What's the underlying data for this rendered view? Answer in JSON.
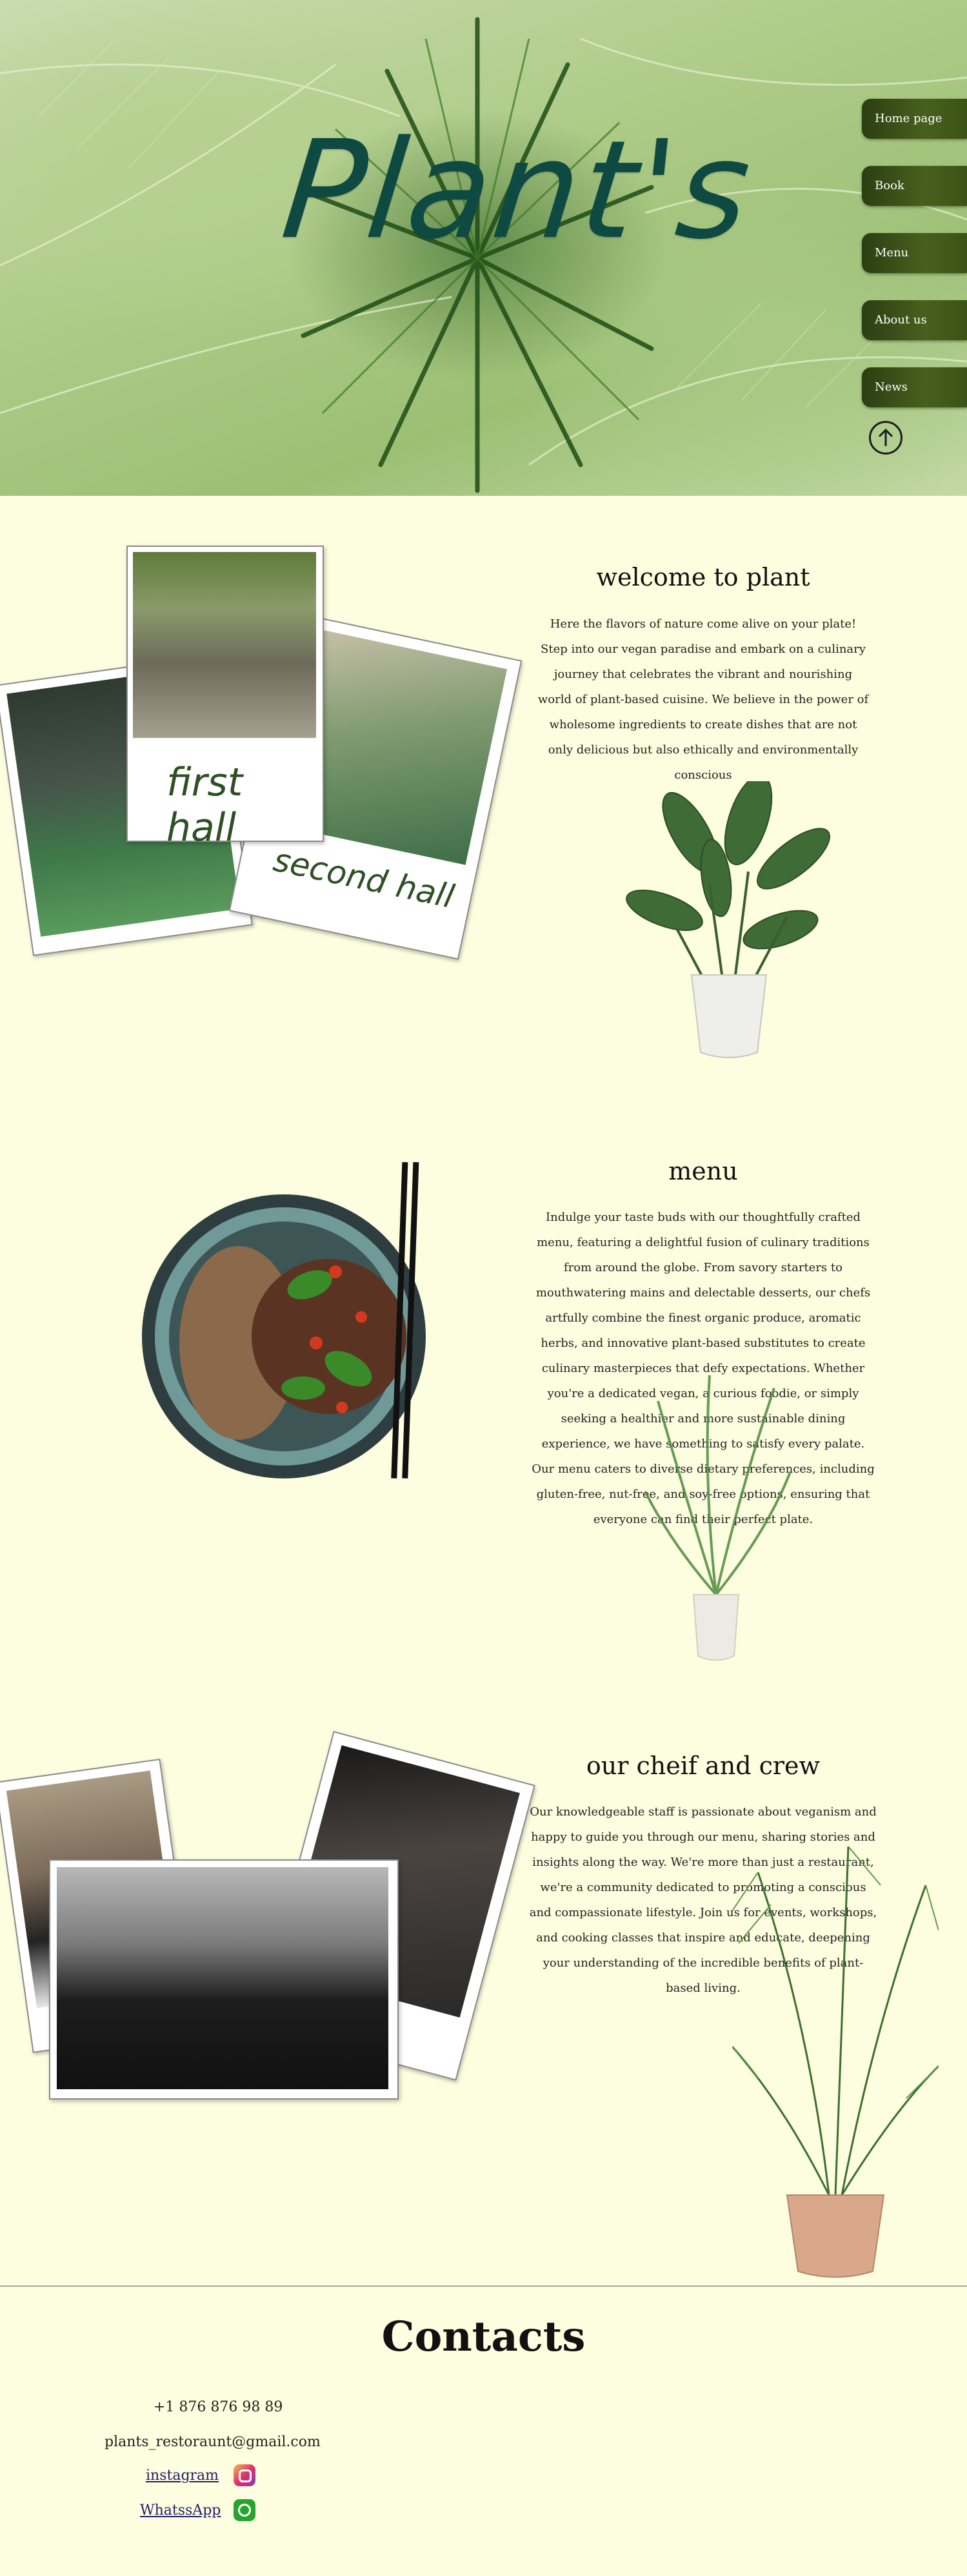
{
  "hero": {
    "title": "Plant's"
  },
  "nav": {
    "items": [
      "Home page",
      "Book",
      "Menu",
      "About us",
      "News"
    ],
    "up_icon": "arrow-up-circle-icon"
  },
  "welcome": {
    "title": "welcome to plant",
    "text": "Here the flavors of nature come alive on your plate! Step into our vegan paradise and embark on a culinary journey that celebrates the vibrant and nourishing world of plant-based cuisine. We believe in the power of wholesome ingredients to create dishes that are not only delicious but also ethically and environmentally conscious",
    "photos": [
      "first hall",
      "second hall"
    ]
  },
  "menu": {
    "title": "menu",
    "text": "Indulge your taste buds with our thoughtfully crafted menu, featuring a delightful fusion of culinary traditions from around the globe. From savory starters to mouthwatering mains and delectable desserts, our chefs artfully combine the finest organic produce, aromatic herbs, and innovative plant-based substitutes to create culinary masterpieces that defy expectations. Whether you're a dedicated vegan, a curious foodie, or simply seeking a healthier and more sustainable dining experience, we have something to satisfy every palate. Our menu caters to diverse dietary preferences, including gluten-free, nut-free, and soy-free options, ensuring that everyone can find their perfect plate."
  },
  "crew": {
    "title": "our cheif and crew",
    "text": "Our knowledgeable staff is passionate about veganism and happy to guide you through our menu, sharing stories and insights along the way. We're more than just a restaurant, we're a community dedicated to promoting a conscious and compassionate lifestyle. Join us for events, workshops, and cooking classes that inspire and educate, deepening your understanding of the incredible benefits of plant-based living."
  },
  "contacts": {
    "title": "Contacts",
    "phone": "+1 876 876 98 89",
    "email": "plants_restoraunt@gmail.com",
    "instagram": "instagram",
    "whatsapp": "WhatssApp",
    "colors": {
      "instagram": "#c13584",
      "whatsapp": "#25a52e"
    }
  }
}
